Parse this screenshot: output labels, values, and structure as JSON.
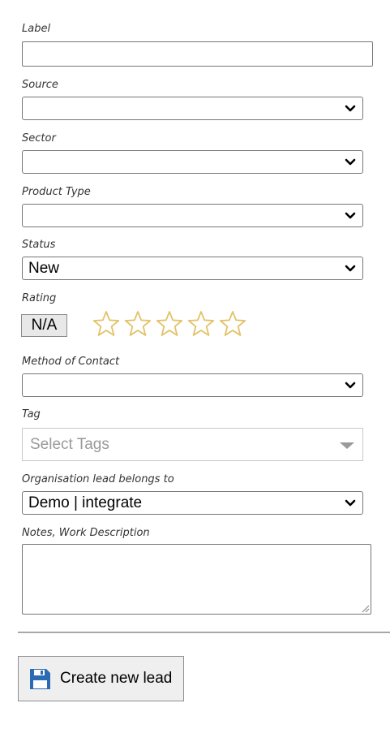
{
  "fields": {
    "label": {
      "label": "Label",
      "value": ""
    },
    "source": {
      "label": "Source",
      "value": ""
    },
    "sector": {
      "label": "Sector",
      "value": ""
    },
    "product_type": {
      "label": "Product Type",
      "value": ""
    },
    "status": {
      "label": "Status",
      "value": "New"
    },
    "rating": {
      "label": "Rating",
      "value": "N/A",
      "stars": 5,
      "filled": 0,
      "star_color": "#e3c168"
    },
    "method_of_contact": {
      "label": "Method of Contact",
      "value": ""
    },
    "tag": {
      "label": "Tag",
      "placeholder": "Select Tags"
    },
    "organisation": {
      "label": "Organisation lead belongs to",
      "value": "Demo | integrate"
    },
    "notes": {
      "label": "Notes, Work Description",
      "value": ""
    }
  },
  "actions": {
    "create_label": "Create new lead",
    "create_icon": "floppy-disk-icon",
    "icon_color": "#2a6bb3"
  }
}
